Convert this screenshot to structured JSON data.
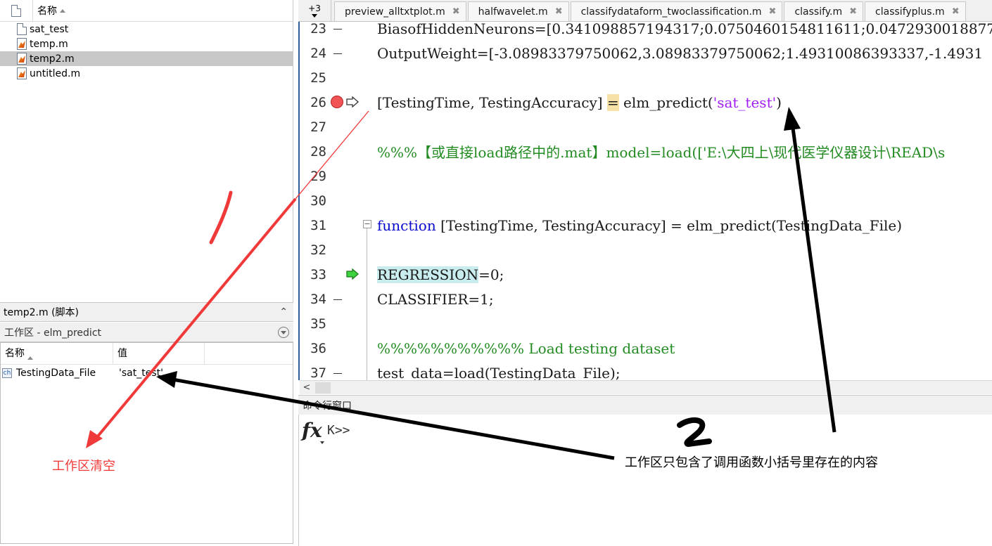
{
  "file_browser": {
    "column_name": "名称",
    "files": [
      {
        "name": "sat_test",
        "icon": "document-icon",
        "selected": false
      },
      {
        "name": "temp.m",
        "icon": "matlab-file-icon",
        "selected": false
      },
      {
        "name": "temp2.m",
        "icon": "matlab-file-icon",
        "selected": true
      },
      {
        "name": "untitled.m",
        "icon": "matlab-file-icon",
        "selected": false
      }
    ]
  },
  "details": {
    "label": "temp2.m  (脚本)"
  },
  "workspace": {
    "title": "工作区 - elm_predict",
    "col_name": "名称",
    "col_value": "值",
    "rows": [
      {
        "name": "TestingData_File",
        "value": "'sat_test'"
      }
    ]
  },
  "editor": {
    "overflow_label": "+3",
    "tabs": [
      {
        "label": "preview_alltxtplot.m"
      },
      {
        "label": "halfwavelet.m"
      },
      {
        "label": "classifydataform_twoclassification.m"
      },
      {
        "label": "classify.m"
      },
      {
        "label": "classifyplus.m"
      }
    ],
    "lines": {
      "n23": "23",
      "c23": "BiasofHiddenNeurons=[0.341098857194317;0.0750460154811611;0.0472930018877",
      "n24": "24",
      "c24": "OutputWeight=[-3.08983379750062,3.08983379750062;1.49310086393337,-1.4931",
      "n25": "25",
      "n26": "26",
      "c26a": "[TestingTime, TestingAccuracy] ",
      "c26b": "=",
      "c26c": " elm_predict(",
      "c26d": "'sat_test'",
      "c26e": ")",
      "n27": "27",
      "n28": "28",
      "c28": "%%%【或直接load路径中的.mat】model=load(['E:\\大四上\\现代医学仪器设计\\READ\\s",
      "n29": "29",
      "n30": "30",
      "n31": "31",
      "c31a": "function",
      "c31b": " [TestingTime, TestingAccuracy] = elm_predict(TestingData_File)",
      "n32": "32",
      "n33": "33",
      "c33a": "REGRESSION",
      "c33b": "=0;",
      "n34": "34",
      "c34": "CLASSIFIER=1;",
      "n35": "35",
      "n36": "36",
      "c36": "%%%%%%%%%%% Load testing dataset",
      "n37": "37",
      "c37": "test_data=load(TestingData_File);"
    }
  },
  "command_window": {
    "title": "命令行窗口",
    "prompt": "K>>",
    "fx": "fx"
  },
  "annotations": {
    "left_label": "工作区清空",
    "right_label": "工作区只包含了调用函数小括号里存在的内容",
    "num1": "1",
    "num2": "2"
  },
  "colors": {
    "annotation_red": "#f03a3a",
    "annotation_black": "#000000",
    "accent_blue": "#2e5c9b"
  }
}
